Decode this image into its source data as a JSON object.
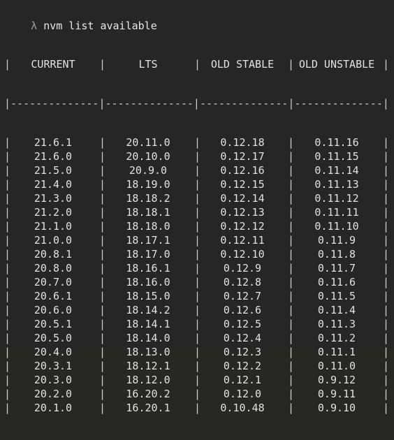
{
  "prompt": {
    "symbol": "λ",
    "command": "nvm list available"
  },
  "table": {
    "headers": [
      "CURRENT",
      "LTS",
      "OLD STABLE",
      "OLD UNSTABLE"
    ],
    "separator": "|--------------|--------------|--------------|--------------|",
    "rows": [
      [
        "21.6.1",
        "20.11.0",
        "0.12.18",
        "0.11.16"
      ],
      [
        "21.6.0",
        "20.10.0",
        "0.12.17",
        "0.11.15"
      ],
      [
        "21.5.0",
        "20.9.0",
        "0.12.16",
        "0.11.14"
      ],
      [
        "21.4.0",
        "18.19.0",
        "0.12.15",
        "0.11.13"
      ],
      [
        "21.3.0",
        "18.18.2",
        "0.12.14",
        "0.11.12"
      ],
      [
        "21.2.0",
        "18.18.1",
        "0.12.13",
        "0.11.11"
      ],
      [
        "21.1.0",
        "18.18.0",
        "0.12.12",
        "0.11.10"
      ],
      [
        "21.0.0",
        "18.17.1",
        "0.12.11",
        "0.11.9"
      ],
      [
        "20.8.1",
        "18.17.0",
        "0.12.10",
        "0.11.8"
      ],
      [
        "20.8.0",
        "18.16.1",
        "0.12.9",
        "0.11.7"
      ],
      [
        "20.7.0",
        "18.16.0",
        "0.12.8",
        "0.11.6"
      ],
      [
        "20.6.1",
        "18.15.0",
        "0.12.7",
        "0.11.5"
      ],
      [
        "20.6.0",
        "18.14.2",
        "0.12.6",
        "0.11.4"
      ],
      [
        "20.5.1",
        "18.14.1",
        "0.12.5",
        "0.11.3"
      ],
      [
        "20.5.0",
        "18.14.0",
        "0.12.4",
        "0.11.2"
      ],
      [
        "20.4.0",
        "18.13.0",
        "0.12.3",
        "0.11.1"
      ],
      [
        "20.3.1",
        "18.12.1",
        "0.12.2",
        "0.11.0"
      ],
      [
        "20.3.0",
        "18.12.0",
        "0.12.1",
        "0.9.12"
      ],
      [
        "20.2.0",
        "16.20.2",
        "0.12.0",
        "0.9.11"
      ],
      [
        "20.1.0",
        "16.20.1",
        "0.10.48",
        "0.9.10"
      ]
    ]
  },
  "colors": {
    "background": "#262626",
    "text": "#e2e2e2",
    "prompt_symbol": "#9e9e9e"
  }
}
